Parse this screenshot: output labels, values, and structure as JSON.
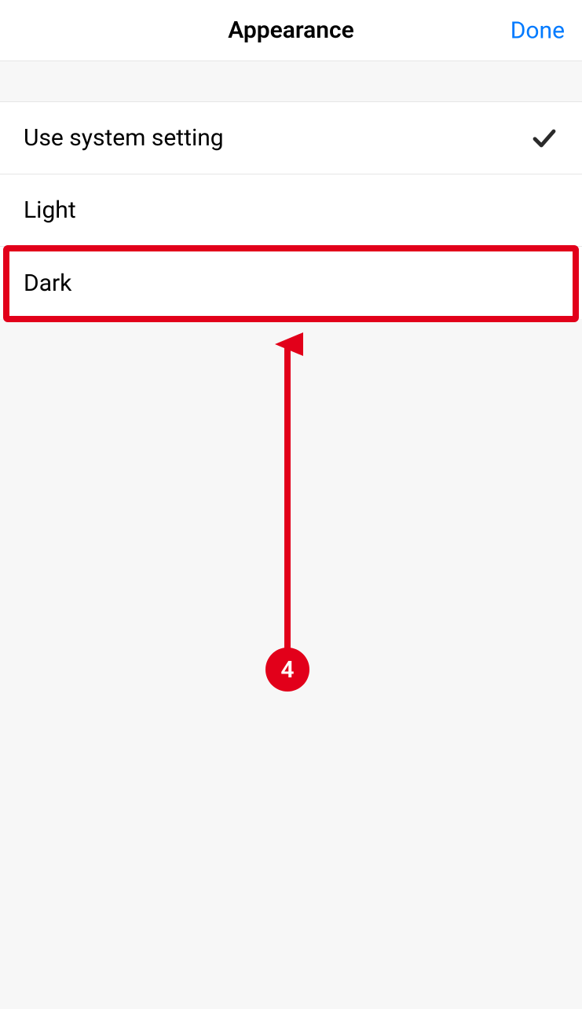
{
  "header": {
    "title": "Appearance",
    "done_label": "Done"
  },
  "options": [
    {
      "label": "Use system setting",
      "selected": true
    },
    {
      "label": "Light",
      "selected": false
    },
    {
      "label": "Dark",
      "selected": false
    }
  ],
  "annotation": {
    "badge_number": "4",
    "highlight_index": 2,
    "colors": {
      "accent": "#e2001a",
      "link": "#007aff"
    }
  }
}
